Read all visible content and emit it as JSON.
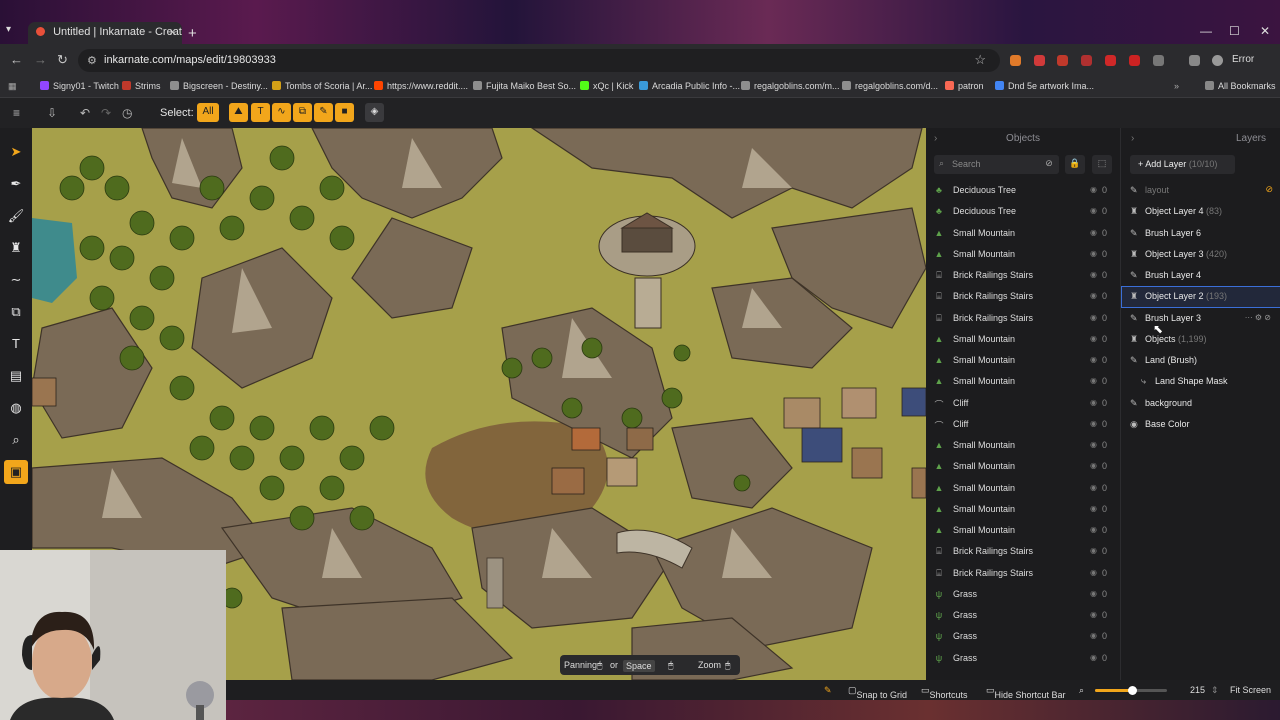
{
  "browser": {
    "tab_title": "Untitled | Inkarnate - Create Fa",
    "url": "inkarnate.com/maps/edit/19803933",
    "error_label": "Error",
    "bookmarks": [
      {
        "label": "Signy01 - Twitch",
        "color": "#9146ff"
      },
      {
        "label": "Strims",
        "color": "#c0392b"
      },
      {
        "label": "Bigscreen - Destiny...",
        "color": "#8e8e8e"
      },
      {
        "label": "Tombs of Scoria | Ar...",
        "color": "#d4a017"
      },
      {
        "label": "https://www.reddit....",
        "color": "#ff4500"
      },
      {
        "label": "Fujita Maiko Best So...",
        "color": "#8e8e8e"
      },
      {
        "label": "xQc | Kick",
        "color": "#53fc18"
      },
      {
        "label": "Arcadia Public Info -...",
        "color": "#3a9ad9"
      },
      {
        "label": "regalgoblins.com/m...",
        "color": "#8e8e8e"
      },
      {
        "label": "regalgoblins.com/d...",
        "color": "#8e8e8e"
      },
      {
        "label": "patron",
        "color": "#f96854"
      },
      {
        "label": "Dnd 5e artwork Ima...",
        "color": "#4285f4"
      }
    ],
    "all_bookmarks": "All Bookmarks"
  },
  "toolbar": {
    "select_label": "Select:",
    "all_label": "All"
  },
  "objects_panel": {
    "title": "Objects",
    "search_placeholder": "Search",
    "items": [
      {
        "name": "Deciduous Tree",
        "count": "0",
        "icon": "tree-icon"
      },
      {
        "name": "Deciduous Tree",
        "count": "0",
        "icon": "tree-icon"
      },
      {
        "name": "Small Mountain",
        "count": "0",
        "icon": "mountain-icon"
      },
      {
        "name": "Small Mountain",
        "count": "0",
        "icon": "mountain-icon"
      },
      {
        "name": "Brick Railings Stairs",
        "count": "0",
        "icon": "stairs-icon"
      },
      {
        "name": "Brick Railings Stairs",
        "count": "0",
        "icon": "stairs-icon"
      },
      {
        "name": "Brick Railings Stairs",
        "count": "0",
        "icon": "stairs-icon"
      },
      {
        "name": "Small Mountain",
        "count": "0",
        "icon": "mountain-icon"
      },
      {
        "name": "Small Mountain",
        "count": "0",
        "icon": "mountain-icon"
      },
      {
        "name": "Small Mountain",
        "count": "0",
        "icon": "mountain-icon"
      },
      {
        "name": "Cliff",
        "count": "0",
        "icon": "cliff-icon"
      },
      {
        "name": "Cliff",
        "count": "0",
        "icon": "cliff-icon"
      },
      {
        "name": "Small Mountain",
        "count": "0",
        "icon": "mountain-icon"
      },
      {
        "name": "Small Mountain",
        "count": "0",
        "icon": "mountain-icon"
      },
      {
        "name": "Small Mountain",
        "count": "0",
        "icon": "mountain-icon"
      },
      {
        "name": "Small Mountain",
        "count": "0",
        "icon": "mountain-icon"
      },
      {
        "name": "Small Mountain",
        "count": "0",
        "icon": "mountain-icon"
      },
      {
        "name": "Brick Railings Stairs",
        "count": "0",
        "icon": "stairs-icon"
      },
      {
        "name": "Brick Railings Stairs",
        "count": "0",
        "icon": "stairs-icon"
      },
      {
        "name": "Grass",
        "count": "0",
        "icon": "grass-icon"
      },
      {
        "name": "Grass",
        "count": "0",
        "icon": "grass-icon"
      },
      {
        "name": "Grass",
        "count": "0",
        "icon": "grass-icon"
      },
      {
        "name": "Grass",
        "count": "0",
        "icon": "grass-icon"
      }
    ]
  },
  "layers_panel": {
    "title": "Layers",
    "add_layer_label": "Add Layer",
    "add_layer_count": "(10/10)",
    "items": [
      {
        "name": "layout",
        "count": "",
        "icon": "brush-icon",
        "dim": true
      },
      {
        "name": "Object Layer 4",
        "count": "(83)",
        "icon": "object-icon"
      },
      {
        "name": "Brush Layer 6",
        "count": "",
        "icon": "brush-icon"
      },
      {
        "name": "Object Layer 3",
        "count": "(420)",
        "icon": "object-icon"
      },
      {
        "name": "Brush Layer 4",
        "count": "",
        "icon": "brush-icon"
      },
      {
        "name": "Object Layer 2",
        "count": "(193)",
        "icon": "object-icon",
        "selected": true
      },
      {
        "name": "Brush Layer 3",
        "count": "",
        "icon": "brush-icon"
      },
      {
        "name": "Objects",
        "count": "(1,199)",
        "icon": "object-icon"
      },
      {
        "name": "Land (Brush)",
        "count": "",
        "icon": "brush-icon"
      },
      {
        "name": "Land Shape Mask",
        "count": "",
        "icon": "mask-icon",
        "sub": true
      },
      {
        "name": "background",
        "count": "",
        "icon": "brush-icon"
      },
      {
        "name": "Base Color",
        "count": "",
        "icon": "color-icon"
      }
    ]
  },
  "hint_bar": {
    "panning": "Panning",
    "or": "or",
    "space": "Space",
    "zoom": "Zoom"
  },
  "status_bar": {
    "snap_to_grid": "Snap to Grid",
    "shortcuts": "Shortcuts",
    "hide_shortcut_bar": "Hide Shortcut Bar",
    "zoom_value": "215",
    "zoom_fraction": 0.52,
    "fit_screen": "Fit Screen"
  },
  "colors": {
    "accent": "#f2a61b",
    "selection": "#3b6fd8",
    "panel_bg": "#1c1c1e"
  }
}
